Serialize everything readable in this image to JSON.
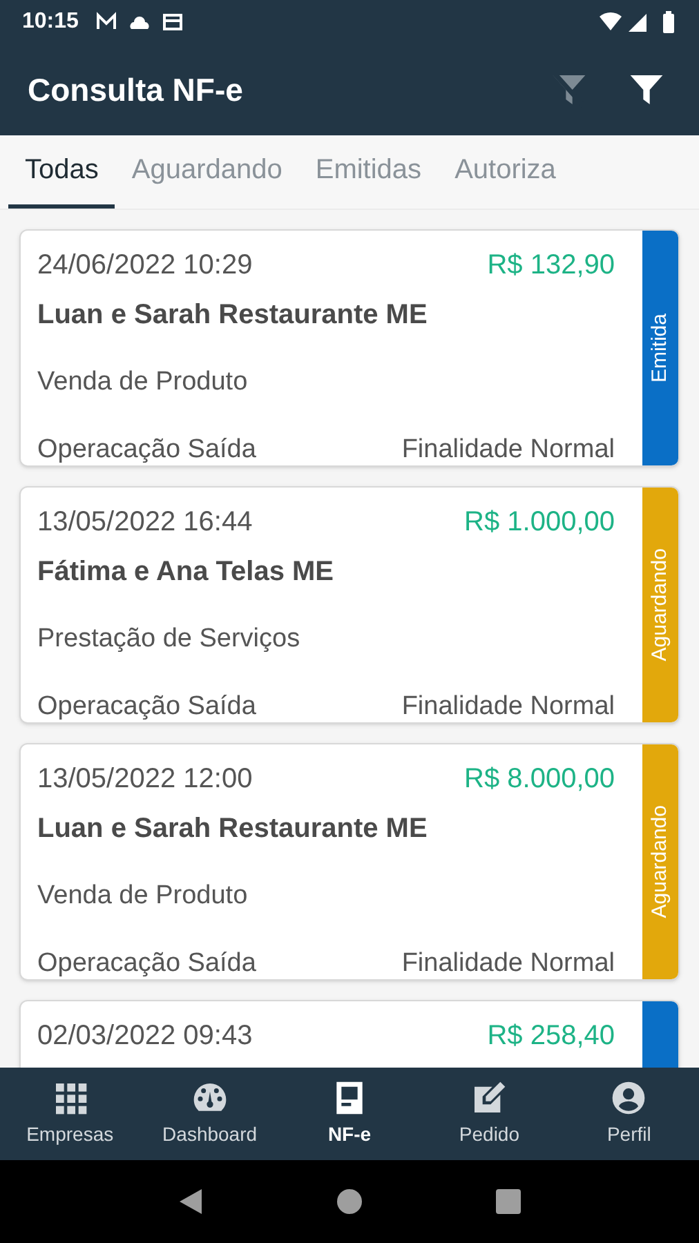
{
  "status_bar": {
    "time": "10:15"
  },
  "app_bar": {
    "title": "Consulta NF-e"
  },
  "tabs": [
    {
      "label": "Todas",
      "selected": true
    },
    {
      "label": "Aguardando",
      "selected": false
    },
    {
      "label": "Emitidas",
      "selected": false
    },
    {
      "label": "Autoriza",
      "selected": false
    }
  ],
  "invoices": [
    {
      "date": "24/06/2022 10:29",
      "amount": "R$ 132,90",
      "customer": "Luan e Sarah Restaurante ME",
      "description": "Venda de Produto",
      "operation": "Operacação Saída",
      "purpose": "Finalidade Normal",
      "status": "Emitida",
      "color": "#0a6fc6"
    },
    {
      "date": "13/05/2022 16:44",
      "amount": "R$ 1.000,00",
      "customer": "Fátima e Ana Telas ME",
      "description": "Prestação de Serviços",
      "operation": "Operacação Saída",
      "purpose": "Finalidade Normal",
      "status": "Aguardando",
      "color": "#e2a80c"
    },
    {
      "date": "13/05/2022 12:00",
      "amount": "R$ 8.000,00",
      "customer": "Luan e Sarah Restaurante ME",
      "description": "Venda de Produto",
      "operation": "Operacação Saída",
      "purpose": "Finalidade Normal",
      "status": "Aguardando",
      "color": "#e2a80c"
    },
    {
      "date": "02/03/2022 09:43",
      "amount": "R$ 258,40",
      "color": "#0a6fc6"
    }
  ],
  "bottom_nav": [
    {
      "label": "Empresas",
      "kind": "grid",
      "selected": false
    },
    {
      "label": "Dashboard",
      "kind": "gauge",
      "selected": false
    },
    {
      "label": "NF-e",
      "kind": "document",
      "selected": true
    },
    {
      "label": "Pedido",
      "kind": "edit",
      "selected": false
    },
    {
      "label": "Perfil",
      "kind": "profile",
      "selected": false
    }
  ]
}
